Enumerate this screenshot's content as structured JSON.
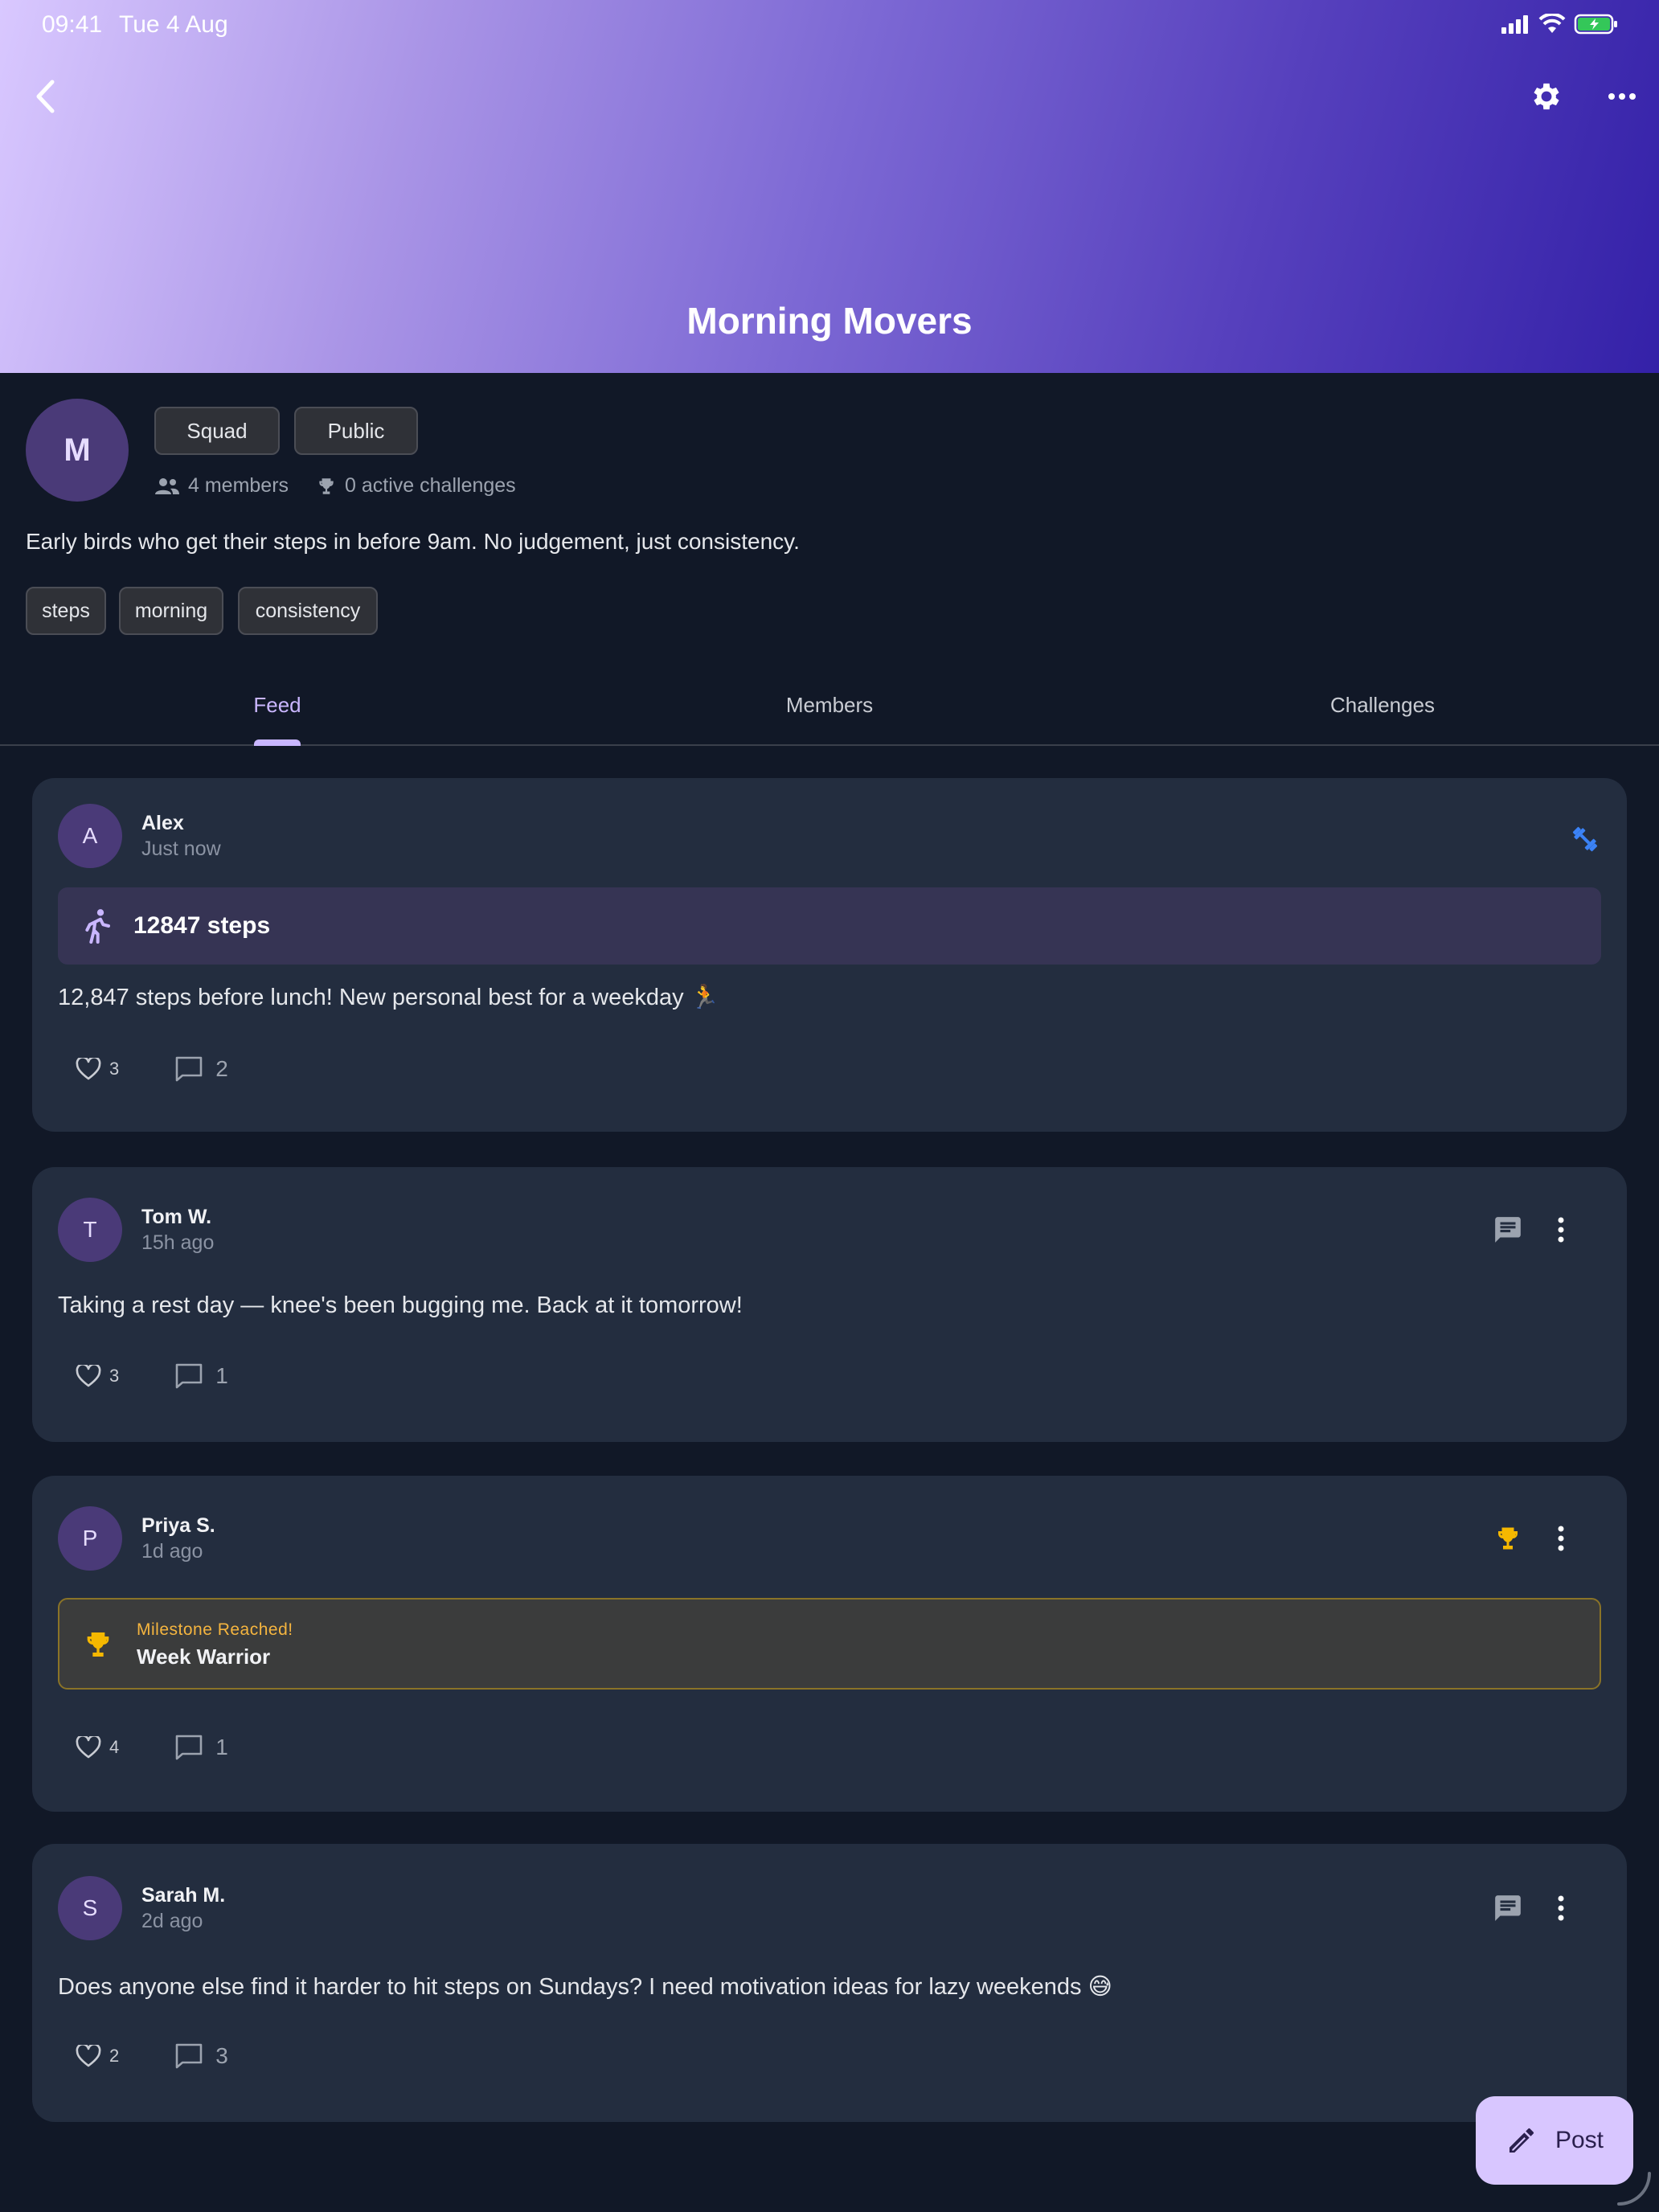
{
  "status_bar": {
    "time": "09:41",
    "date": "Tue 4 Aug"
  },
  "header": {
    "title": "Morning Movers"
  },
  "group": {
    "avatar_letter": "M",
    "badges": [
      "Squad",
      "Public"
    ],
    "members": "4 members",
    "challenges": "0 active challenges",
    "description": "Early birds who get their steps in before 9am. No judgement, just consistency.",
    "tags": [
      "steps",
      "morning",
      "consistency"
    ]
  },
  "tabs": [
    {
      "label": "Feed",
      "active": true
    },
    {
      "label": "Members",
      "active": false
    },
    {
      "label": "Challenges",
      "active": false
    }
  ],
  "posts": [
    {
      "avatar": "A",
      "name": "Alex",
      "time": "Just now",
      "activity": {
        "icon": "running-icon",
        "value": "12847 steps"
      },
      "text": "12,847 steps before lunch! New personal best for a weekday 🏃",
      "likes": "3",
      "comments": "2",
      "header_icon": "fitness-icon"
    },
    {
      "avatar": "T",
      "name": "Tom W.",
      "time": "15h ago",
      "text": "Taking a rest day — knee's been bugging me. Back at it tomorrow!",
      "likes": "3",
      "comments": "1",
      "header_icon": "message-icon"
    },
    {
      "avatar": "P",
      "name": "Priya S.",
      "time": "1d ago",
      "milestone": {
        "label": "Milestone Reached!",
        "title": "Week Warrior"
      },
      "likes": "4",
      "comments": "1",
      "header_icon": "trophy-icon"
    },
    {
      "avatar": "S",
      "name": "Sarah M.",
      "time": "2d ago",
      "text": "Does anyone else find it harder to hit steps on Sundays? I need motivation ideas for lazy weekends 😅",
      "likes": "2",
      "comments": "3",
      "header_icon": "message-icon"
    }
  ],
  "fab": {
    "label": "Post",
    "icon": "pencil-icon"
  },
  "colors": {
    "accent": "#c9b6ff",
    "card": "#232d3f",
    "background": "#111827",
    "trophy": "#f5b800",
    "fitness": "#3b82f6"
  }
}
